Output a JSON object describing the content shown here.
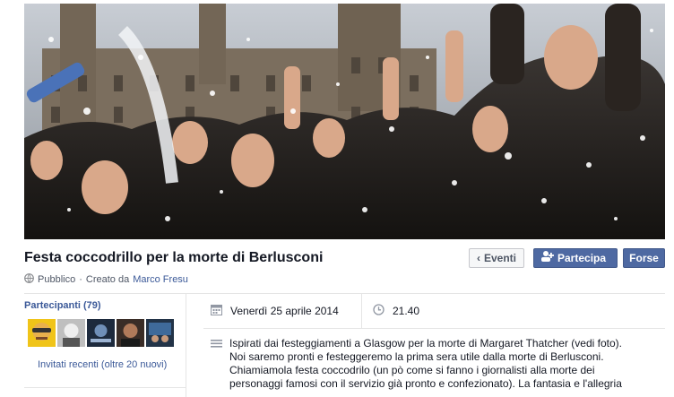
{
  "event": {
    "title": "Festa coccodrillo per la morte di Berlusconi",
    "privacy": "Pubblico",
    "created_by_prefix": "Creato da",
    "creator": "Marco Fresu"
  },
  "buttons": {
    "back": "Eventi",
    "join": "Partecipa",
    "more": "Forse"
  },
  "participants": {
    "title": "Partecipanti (79)",
    "invited": "Invitati recenti (oltre 20 nuovi)"
  },
  "details": {
    "date": "Venerdì 25 aprile 2014",
    "time": "21.40"
  },
  "description": [
    "Ispirati dai festeggiamenti a Glasgow per la morte di Margaret Thatcher (vedi foto).",
    "Noi saremo pronti e festeggeremo la prima sera utile dalla morte di Berlusconi.",
    "Chiamiamola festa coccodrilo (un pò come si fanno i giornalisti alla morte dei",
    "personaggi famosi con il servizio già pronto e confezionato). La fantasia e l'allegria"
  ],
  "colors": {
    "link": "#3b5998",
    "primary_button": "#4e69a2"
  },
  "icons": [
    "globe-icon",
    "chevron-left-icon",
    "add-user-icon",
    "calendar-icon",
    "clock-icon",
    "description-lines-icon"
  ]
}
